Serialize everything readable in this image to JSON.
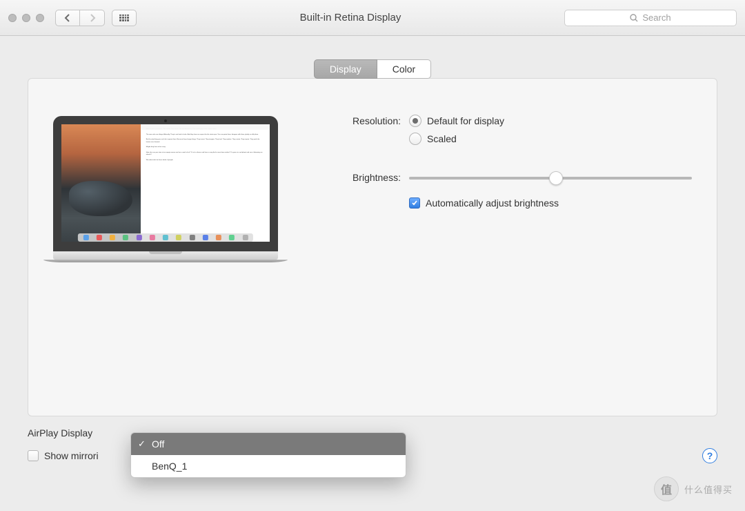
{
  "window": {
    "title": "Built-in Retina Display"
  },
  "search": {
    "placeholder": "Search"
  },
  "tabs": {
    "display": "Display",
    "color": "Color"
  },
  "settings": {
    "resolution_label": "Resolution:",
    "res_default": "Default for display",
    "res_scaled": "Scaled",
    "brightness_label": "Brightness:",
    "auto_bright": "Automatically adjust brightness"
  },
  "footer": {
    "airplay_label": "AirPlay Display",
    "mirroring": "Show mirrori"
  },
  "dropdown": {
    "options": [
      "Off",
      "BenQ_1"
    ],
    "opt0": "Off",
    "opt1": "BenQ_1"
  },
  "watermark": {
    "badge": "值",
    "text": "什么值得买"
  }
}
